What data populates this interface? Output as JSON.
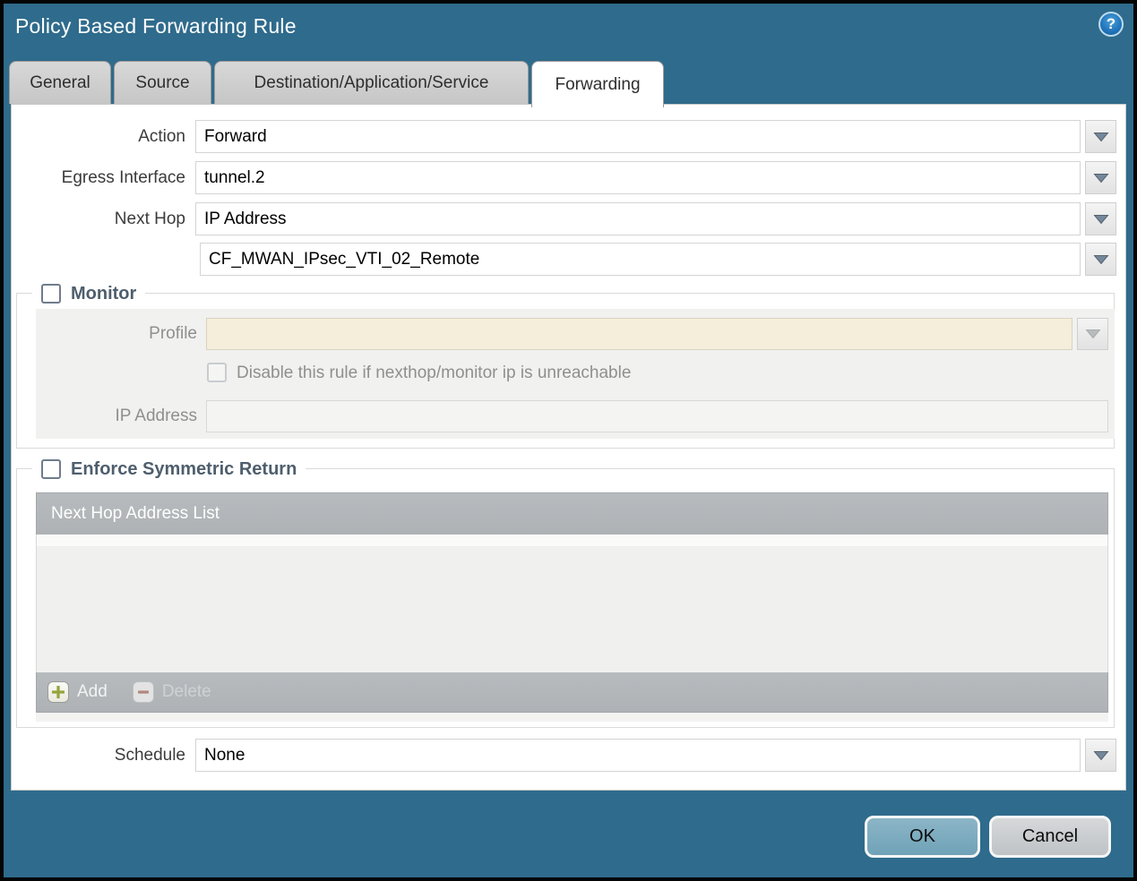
{
  "window": {
    "title": "Policy Based Forwarding Rule"
  },
  "icons": {
    "help_glyph": "?"
  },
  "tabs": [
    {
      "label": "General",
      "active": false
    },
    {
      "label": "Source",
      "active": false
    },
    {
      "label": "Destination/Application/Service",
      "active": false
    },
    {
      "label": "Forwarding",
      "active": true
    }
  ],
  "form": {
    "action": {
      "label": "Action",
      "value": "Forward"
    },
    "egress_interface": {
      "label": "Egress Interface",
      "value": "tunnel.2"
    },
    "next_hop": {
      "label": "Next Hop",
      "value": "IP Address"
    },
    "next_hop_address": {
      "value": "CF_MWAN_IPsec_VTI_02_Remote"
    },
    "schedule": {
      "label": "Schedule",
      "value": "None"
    }
  },
  "monitor": {
    "legend": "Monitor",
    "checked": false,
    "profile": {
      "label": "Profile",
      "value": ""
    },
    "disable_rule": {
      "label": "Disable this rule if nexthop/monitor ip is unreachable",
      "checked": false
    },
    "ip_address": {
      "label": "IP Address",
      "value": ""
    }
  },
  "enforce_symmetric_return": {
    "legend": "Enforce Symmetric Return",
    "checked": false,
    "table": {
      "header": "Next Hop Address List",
      "rows": []
    },
    "toolbar": {
      "add_label": "Add",
      "delete_label": "Delete"
    }
  },
  "footer": {
    "ok_label": "OK",
    "cancel_label": "Cancel"
  },
  "colors": {
    "titlebar": "#2F6B8C",
    "tab_inactive": "#CDCDCD",
    "panel": "#FFFFFF",
    "section_bg": "#F1F1EF",
    "disabled_input_beige": "#F5EEDB",
    "grid_header": "#B1B5B8",
    "ok_button": "#7AAABE",
    "cancel_button": "#C9CCCE",
    "add_icon_green": "#96A53C",
    "delete_icon_red": "#B1887E",
    "help_icon_blue": "#2277BE"
  }
}
